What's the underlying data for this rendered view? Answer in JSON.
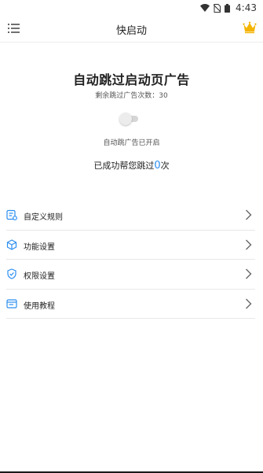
{
  "status_bar": {
    "time": "4:43",
    "icons": [
      "wifi-icon",
      "no-sim-icon",
      "battery-icon"
    ]
  },
  "app_bar": {
    "title": "快启动",
    "menu_icon": "menu-list-icon",
    "vip_icon": "crown-icon",
    "accent": "#f4b400"
  },
  "hero": {
    "title": "自动跳过启动页广告",
    "remaining_text": "剩余跳过广告次数：30",
    "toggle_label": "自动跳广告已开启",
    "skipped_prefix": "已成功帮您跳过",
    "skipped_count": "0",
    "skipped_suffix": "次",
    "accent_color": "#2b8ef0"
  },
  "menu": [
    {
      "label": "自定义规则",
      "icon": "custom-rules-icon"
    },
    {
      "label": "功能设置",
      "icon": "cube-icon"
    },
    {
      "label": "权限设置",
      "icon": "shield-icon"
    },
    {
      "label": "使用教程",
      "icon": "tutorial-icon"
    }
  ]
}
